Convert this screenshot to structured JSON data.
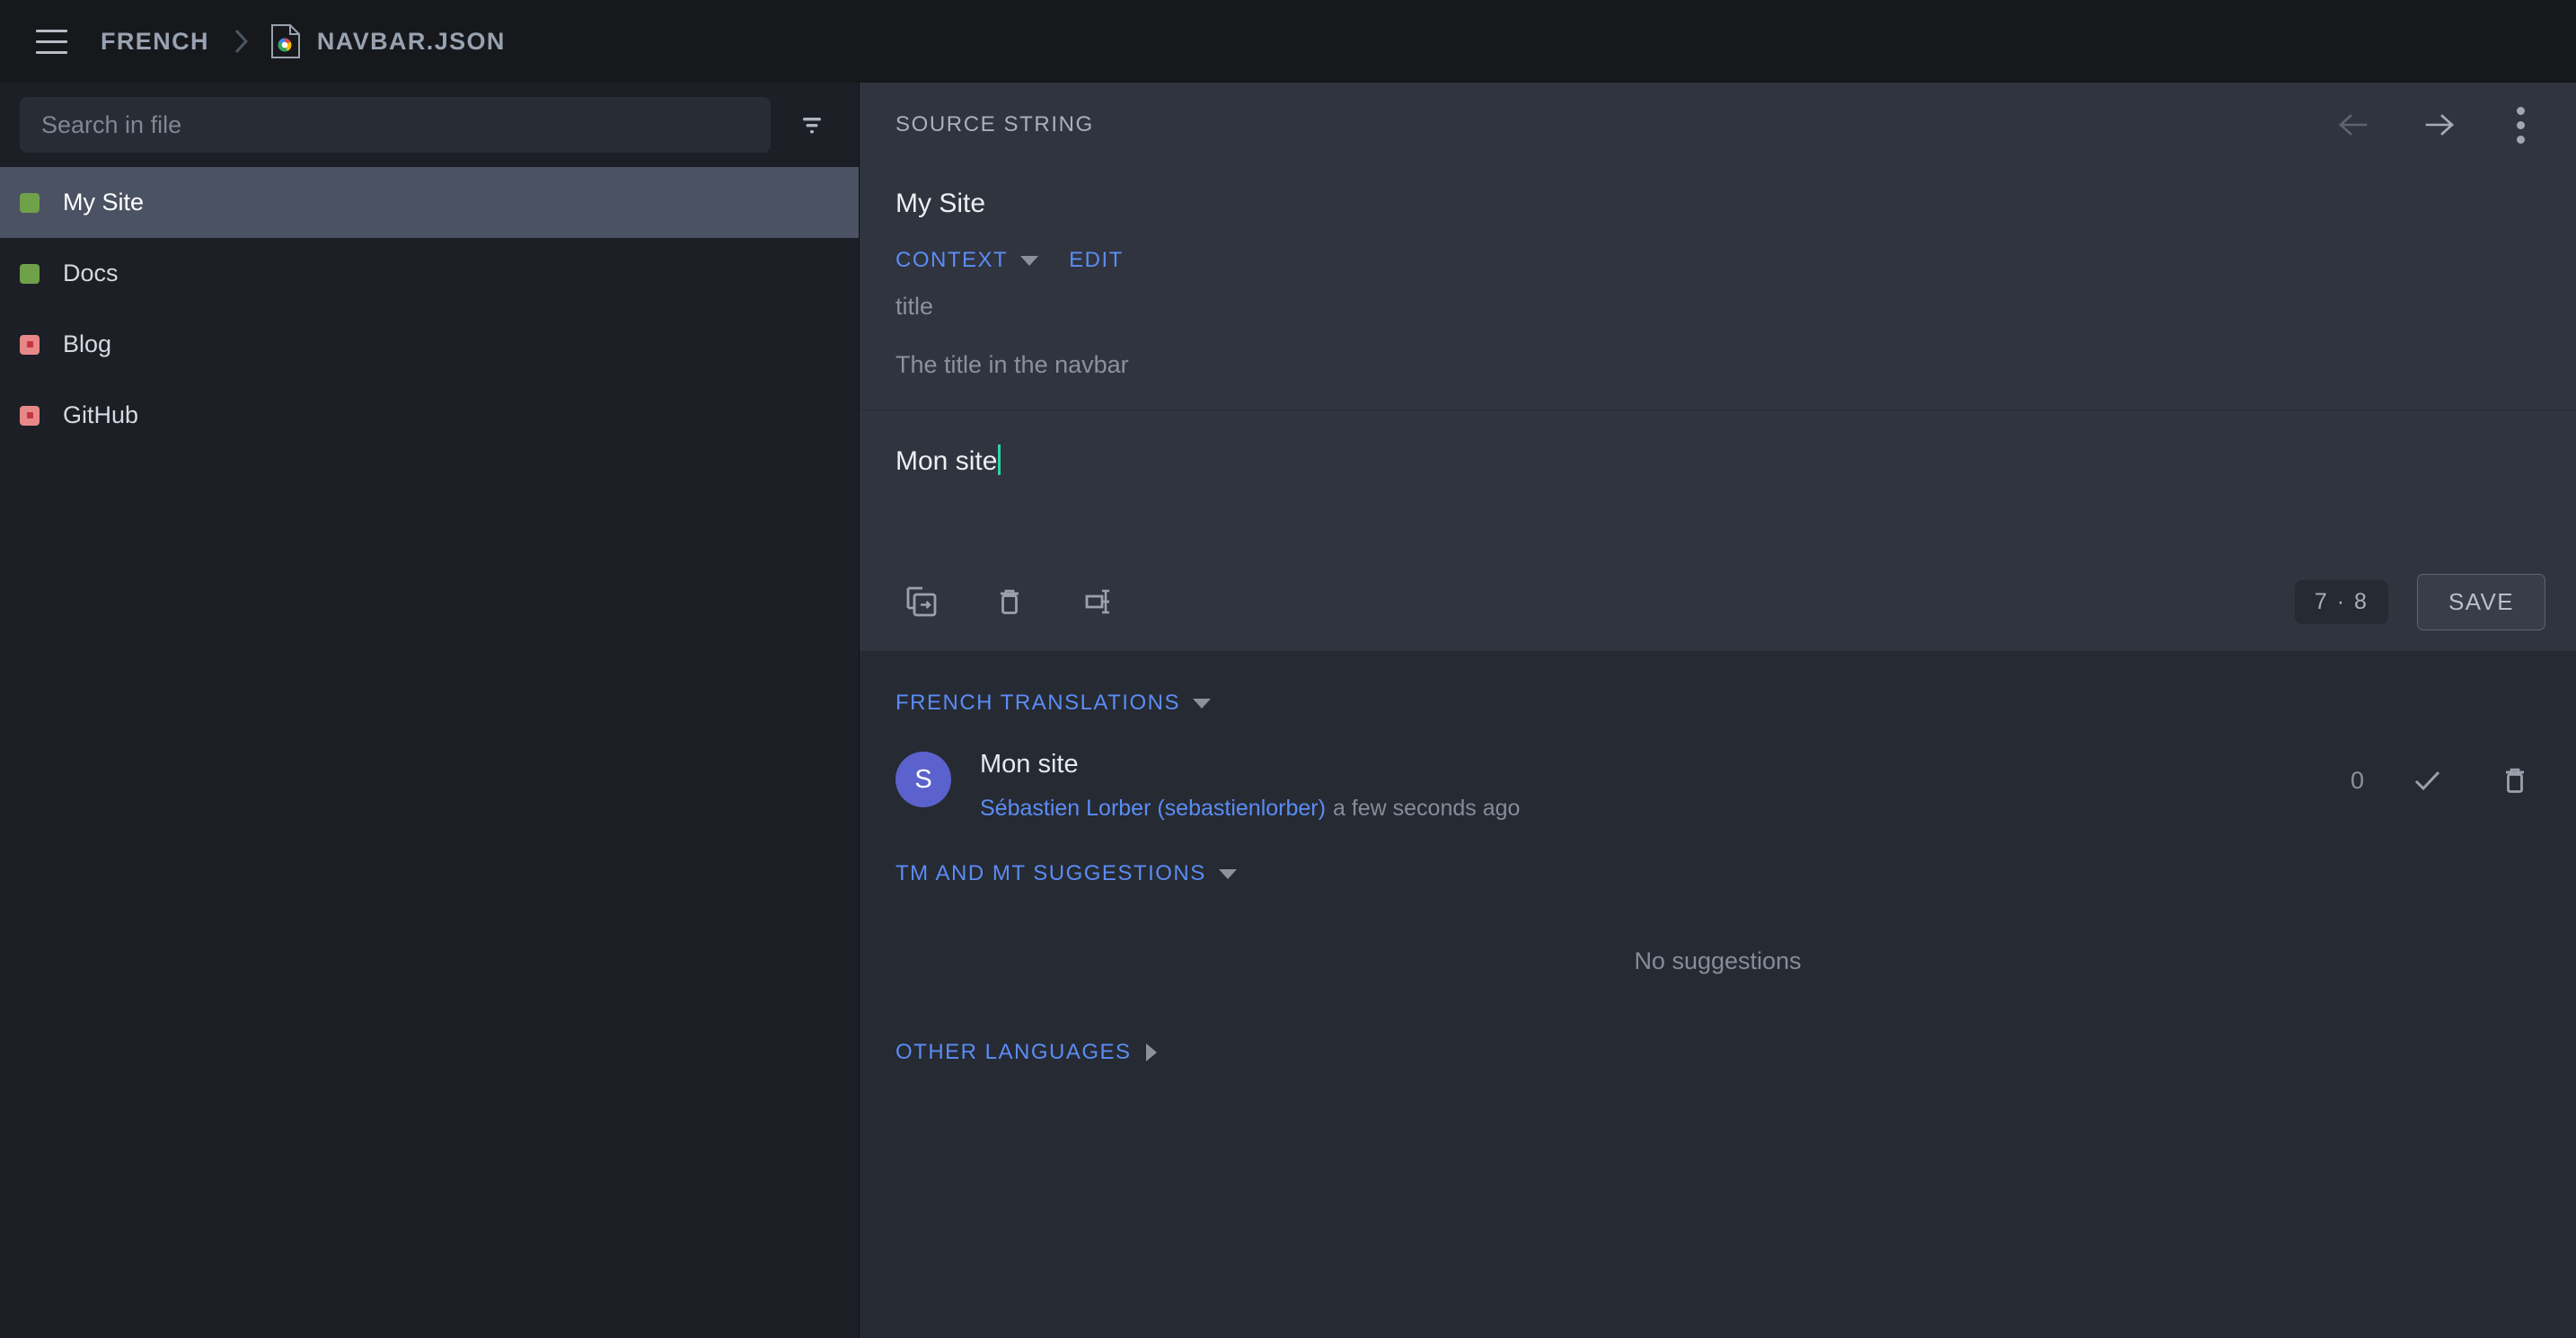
{
  "topbar": {
    "menu_icon": "hamburger-menu-icon",
    "breadcrumb": {
      "language": "FRENCH",
      "separator_icon": "chevron-right-icon",
      "file_icon": "chrome-file-icon",
      "file": "NAVBAR.JSON"
    }
  },
  "sidebar": {
    "search": {
      "placeholder": "Search in file",
      "value": "",
      "filter_icon": "filter-icon"
    },
    "entries": [
      {
        "label": "My Site",
        "status": "green",
        "selected": true
      },
      {
        "label": "Docs",
        "status": "green",
        "selected": false
      },
      {
        "label": "Blog",
        "status": "red",
        "selected": false
      },
      {
        "label": "GitHub",
        "status": "red",
        "selected": false
      }
    ]
  },
  "source_panel": {
    "header_title": "SOURCE STRING",
    "prev_icon": "arrow-left-icon",
    "next_icon": "arrow-right-icon",
    "more_icon": "kebab-menu-icon",
    "source_string": "My Site",
    "context_label": "CONTEXT",
    "edit_label": "EDIT",
    "context_key": "title",
    "context_description": "The title in the navbar"
  },
  "editor": {
    "value": "Mon site",
    "caret_color": "#2ed3a5",
    "tools": [
      {
        "icon": "copy-source-icon"
      },
      {
        "icon": "clear-trash-icon"
      },
      {
        "icon": "toggle-whitespace-icon"
      }
    ],
    "counter": "7 · 8",
    "save_label": "SAVE"
  },
  "translations": {
    "section_label": "FRENCH TRANSLATIONS",
    "items": [
      {
        "avatar_initial": "S",
        "text": "Mon site",
        "author": "Sébastien Lorber (sebastienlorber)",
        "time": "a few seconds ago",
        "votes": "0",
        "approve_icon": "check-icon",
        "delete_icon": "trash-icon"
      }
    ]
  },
  "suggestions": {
    "section_label": "TM AND MT SUGGESTIONS",
    "empty_text": "No suggestions"
  },
  "other_languages": {
    "section_label": "OTHER LANGUAGES"
  },
  "colors": {
    "accent_link": "#5b8cf5",
    "status_green": "#6fa14b",
    "status_red": "#e8888a",
    "avatar_bg": "#5b62cd",
    "caret": "#2ed3a5"
  }
}
